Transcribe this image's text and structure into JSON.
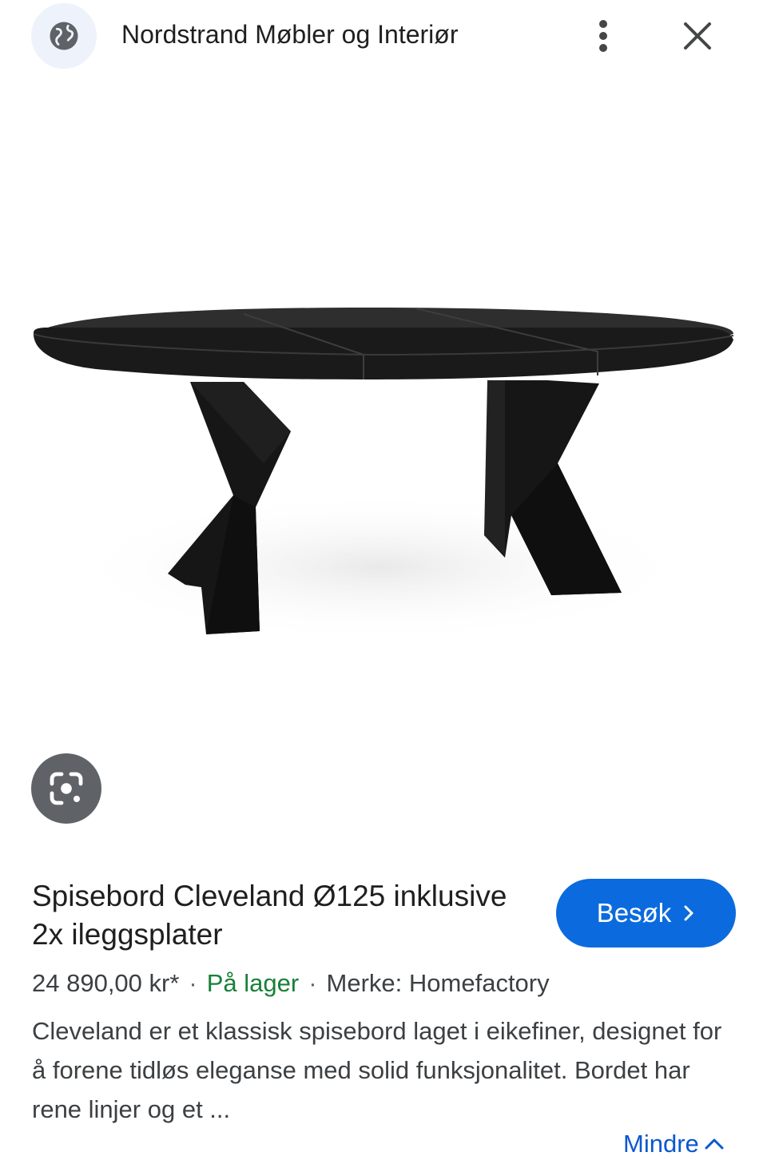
{
  "header": {
    "site_icon": "globe-icon",
    "site_name": "Nordstrand Møbler og Interiør",
    "more_icon": "more-vertical-icon",
    "close_icon": "close-icon"
  },
  "image": {
    "subject": "black oval extension dining table with two slanted legs"
  },
  "lens_icon": "google-lens-icon",
  "product": {
    "title": "Spisebord Cleveland Ø125 inklusive 2x ileggsplater",
    "price": "24 890,00 kr*",
    "separator": "·",
    "stock": "På lager",
    "brand": "Merke: Homefactory",
    "description": "Cleveland er et klassisk spisebord laget i eikefiner, designet for å forene tidløs eleganse med solid funksjonalitet. Bordet har rene linjer og et ..."
  },
  "visit_button": {
    "label": "Besøk",
    "icon": "chevron-right-icon"
  },
  "less_link": {
    "label": "Mindre",
    "icon": "chevron-up-icon"
  },
  "colors": {
    "accent_button": "#0b6bde",
    "link": "#0b57d0",
    "in_stock": "#188038",
    "table": "#1d1d1d"
  }
}
